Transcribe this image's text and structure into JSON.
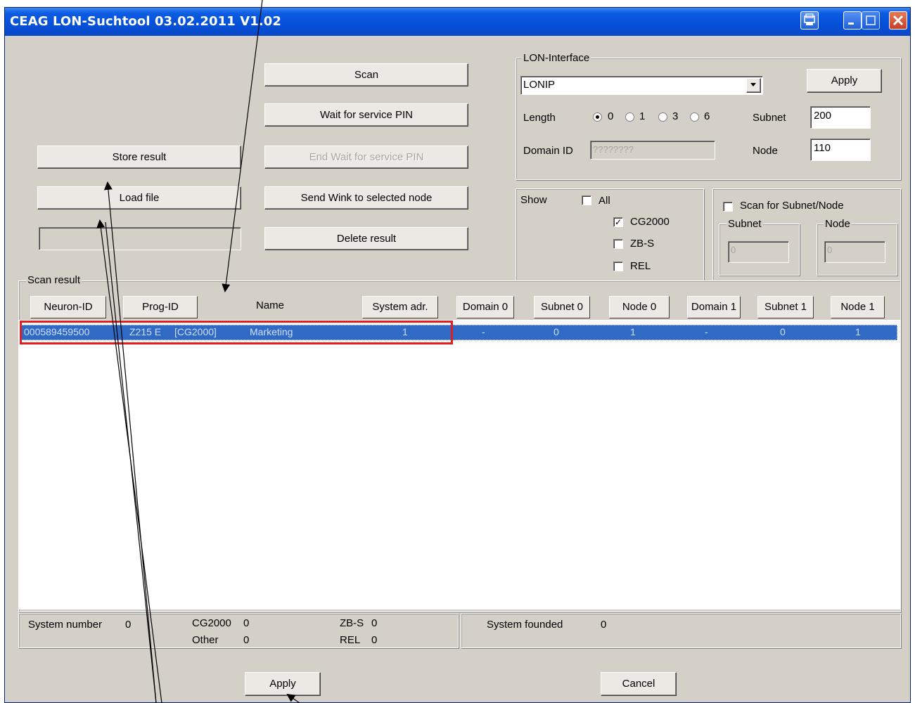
{
  "window": {
    "title": "CEAG LON-Suchtool 03.02.2011 V1.02"
  },
  "buttons": {
    "scan": "Scan",
    "wait_service_pin": "Wait for service PIN",
    "end_wait_service_pin": "End Wait for service PIN",
    "send_wink": "Send Wink to selected node",
    "delete_result": "Delete result",
    "store_result": "Store result",
    "load_file": "Load file",
    "apply_bottom": "Apply",
    "cancel": "Cancel"
  },
  "lon_interface": {
    "group_label": "LON-Interface",
    "interface_value": "LONIP",
    "apply_label": "Apply",
    "length_label": "Length",
    "length_options": [
      "0",
      "1",
      "3",
      "6"
    ],
    "length_selected": "0",
    "subnet_label": "Subnet",
    "subnet_value": "200",
    "domain_id_label": "Domain ID",
    "domain_id_value": "????????",
    "node_label": "Node",
    "node_value": "110"
  },
  "show": {
    "label": "Show",
    "all": {
      "label": "All",
      "checked": false
    },
    "cg2000": {
      "label": "CG2000",
      "checked": true
    },
    "zbs": {
      "label": "ZB-S",
      "checked": false
    },
    "rel": {
      "label": "REL",
      "checked": false
    }
  },
  "scan_subnet_node": {
    "checkbox_label": "Scan for Subnet/Node",
    "checked": false,
    "subnet_group": "Subnet",
    "subnet_value": "0",
    "node_group": "Node",
    "node_value": "0"
  },
  "scan_result": {
    "group_label": "Scan result",
    "columns": [
      "Neuron-ID",
      "Prog-ID",
      "Name",
      "System adr.",
      "Domain 0",
      "Subnet 0",
      "Node 0",
      "Domain 1",
      "Subnet 1",
      "Node 1"
    ],
    "rows": [
      {
        "neuron_id": "000589459500",
        "prog_id": "Z215 E",
        "prog_type": "[CG2000]",
        "name": "Marketing",
        "system_adr": "1",
        "domain0": "-",
        "subnet0": "0",
        "node0": "1",
        "domain1": "-",
        "subnet1": "0",
        "node1": "1"
      }
    ]
  },
  "summary": {
    "system_number_label": "System number",
    "system_number_value": "0",
    "cg2000_label": "CG2000",
    "cg2000_value": "0",
    "other_label": "Other",
    "other_value": "0",
    "zbs_label": "ZB-S",
    "zbs_value": "0",
    "rel_label": "REL",
    "rel_value": "0",
    "system_founded_label": "System founded",
    "system_founded_value": "0"
  },
  "colors": {
    "titlebar": "#0a48c8",
    "selection": "#316ac5",
    "highlight_box": "#e02020",
    "dialog_bg": "#d4d0c8"
  }
}
